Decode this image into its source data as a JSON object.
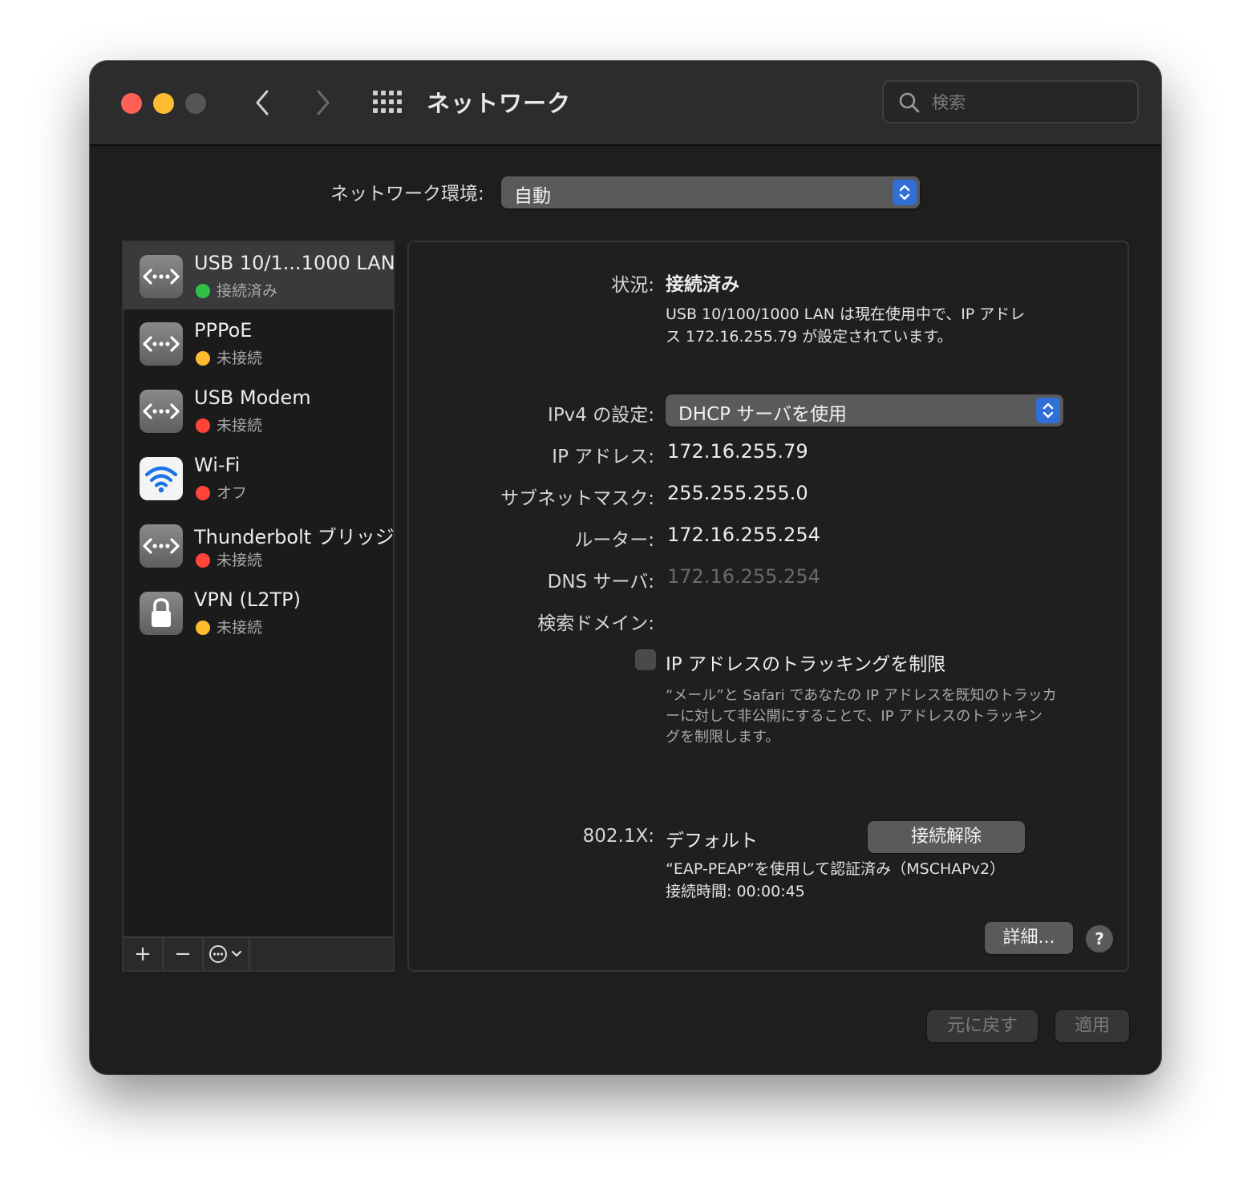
{
  "window": {
    "title": "ネットワーク",
    "search_placeholder": "検索"
  },
  "location": {
    "label": "ネットワーク環境:",
    "value": "自動"
  },
  "services": [
    {
      "name": "USB 10/1...1000 LAN",
      "status": "接続済み",
      "status_color": "#30c048",
      "icon": "ethernet-icon",
      "selected": true
    },
    {
      "name": "PPPoE",
      "status": "未接続",
      "status_color": "#febc2e",
      "icon": "ethernet-icon"
    },
    {
      "name": "USB Modem",
      "status": "未接続",
      "status_color": "#ff453a",
      "icon": "ethernet-icon"
    },
    {
      "name": "Wi-Fi",
      "status": "オフ",
      "status_color": "#ff453a",
      "icon": "wifi-icon"
    },
    {
      "name": "Thunderbolt ブリッジ",
      "status": "未接続",
      "status_color": "#ff453a",
      "icon": "ethernet-icon"
    },
    {
      "name": "VPN (L2TP)",
      "status": "未接続",
      "status_color": "#febc2e",
      "icon": "lock-icon"
    }
  ],
  "sidebar_buttons": {
    "add": "+",
    "remove": "−"
  },
  "detail": {
    "status_label": "状況:",
    "status_value": "接続済み",
    "status_desc_1": "USB 10/100/1000 LAN は現在使用中で、IP アドレ",
    "status_desc_2": "ス 172.16.255.79 が設定されています。",
    "ipv4_label": "IPv4 の設定:",
    "ipv4_value": "DHCP サーバを使用",
    "ip_label": "IP アドレス:",
    "ip_value": "172.16.255.79",
    "subnet_label": "サブネットマスク:",
    "subnet_value": "255.255.255.0",
    "router_label": "ルーター:",
    "router_value": "172.16.255.254",
    "dns_label": "DNS サーバ:",
    "dns_value": "172.16.255.254",
    "search_domain_label": "検索ドメイン:",
    "tracking_label": "IP アドレスのトラッキングを制限",
    "tracking_note_1": "“メール”と Safari であなたの IP アドレスを既知のトラッカ",
    "tracking_note_2": "ーに対して非公開にすることで、IP アドレスのトラッキン",
    "tracking_note_3": "グを制限します。",
    "dot1x_label": "802.1X:",
    "dot1x_value": "デフォルト",
    "disconnect_button": "接続解除",
    "auth_info": "“EAP-PEAP”を使用して認証済み（MSCHAPv2）",
    "connect_time": "接続時間: 00:00:45",
    "advanced_button": "詳細...",
    "help_button": "?"
  },
  "footer": {
    "revert_button": "元に戻す",
    "apply_button": "適用"
  }
}
